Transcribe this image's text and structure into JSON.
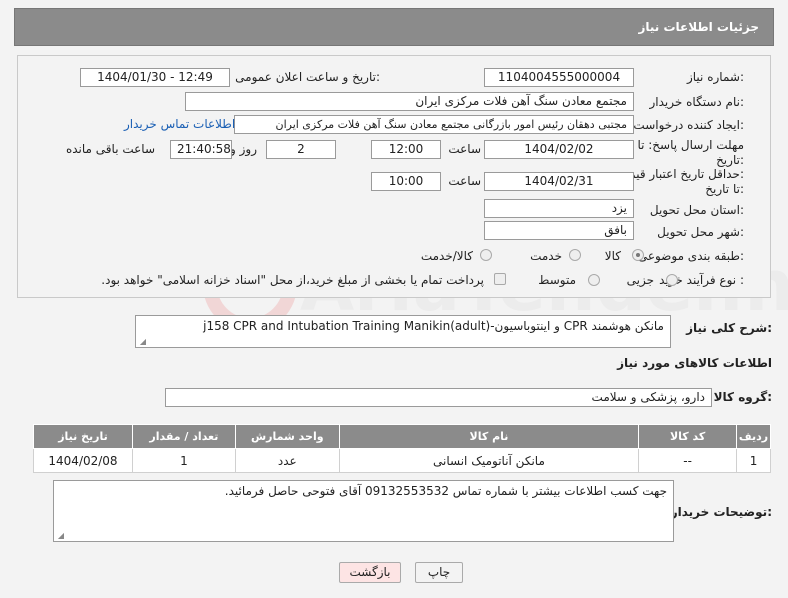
{
  "header": {
    "title": "جزئیات اطلاعات نیاز"
  },
  "form": {
    "need_number_label": "شماره نیاز:",
    "need_number": "1104004555000004",
    "announce_label": "تاریخ و ساعت اعلان عمومی:",
    "announce_value": "1404/01/30 - 12:49",
    "buyer_org_label": "نام دستگاه خریدار:",
    "buyer_org": "مجتمع معادن سنگ آهن فلات مرکزی ایران",
    "creator_label": "ایجاد کننده درخواست:",
    "creator": "مجتبی  دهقان رئیس امور بازرگانی مجتمع معادن سنگ آهن فلات مرکزی ایران",
    "buyer_contact_link": "اطلاعات تماس خریدار",
    "deadline_label_1": "مهلت ارسال پاسخ: تا",
    "deadline_label_2": "تاریخ:",
    "deadline_date": "1404/02/02",
    "time_label": "ساعت",
    "deadline_time": "12:00",
    "days_value": "2",
    "days_label": "روز و",
    "remaining_time": "21:40:58",
    "remaining_label": "ساعت باقی مانده",
    "validity_label_1": "حداقل تاریخ اعتبار قیمت:",
    "validity_label_2": "تا تاریخ:",
    "validity_date": "1404/02/31",
    "validity_time": "10:00",
    "province_label": "استان محل تحویل:",
    "province": "یزد",
    "city_label": "شهر محل تحویل:",
    "city": "بافق",
    "category_label": "طبقه بندی موضوعی:",
    "category_options": [
      "کالا",
      "خدمت",
      "کالا/خدمت"
    ],
    "process_label": "نوع فرآیند خرید :",
    "process_options": [
      "جزیی",
      "متوسط"
    ],
    "payment_note": "پرداخت تمام یا بخشی از مبلغ خرید،از محل \"اسناد خزانه اسلامی\" خواهد بود."
  },
  "summary": {
    "label": "شرح کلی نیاز:",
    "value": "مانکن هوشمند CPR و اینتوباسیون-(j158 CPR and Intubation Training Manikin(adult"
  },
  "goods": {
    "section_title": "اطلاعات کالاهای مورد نیاز",
    "group_label": "گروه کالا:",
    "group_value": "دارو، پزشکی و سلامت",
    "columns": [
      "ردیف",
      "کد کالا",
      "نام کالا",
      "واحد شمارش",
      "تعداد / مقدار",
      "تاریخ نیاز"
    ],
    "rows": [
      [
        "1",
        "--",
        "مانکن آناتومیک انسانی",
        "عدد",
        "1",
        "1404/02/08"
      ]
    ]
  },
  "buyer_notes": {
    "label": "توضیحات خریدار:",
    "value": "جهت کسب اطلاعات بیشتر با شماره تماس 09132553532 آقای فتوحی حاصل فرمائید."
  },
  "buttons": {
    "print": "چاپ",
    "back": "بازگشت"
  },
  "watermark": {
    "text": "AriaTender.net"
  },
  "colors": {
    "header_bg": "#8b8b8b",
    "link": "#1a5fb4",
    "back_btn": "#fde4e4"
  }
}
